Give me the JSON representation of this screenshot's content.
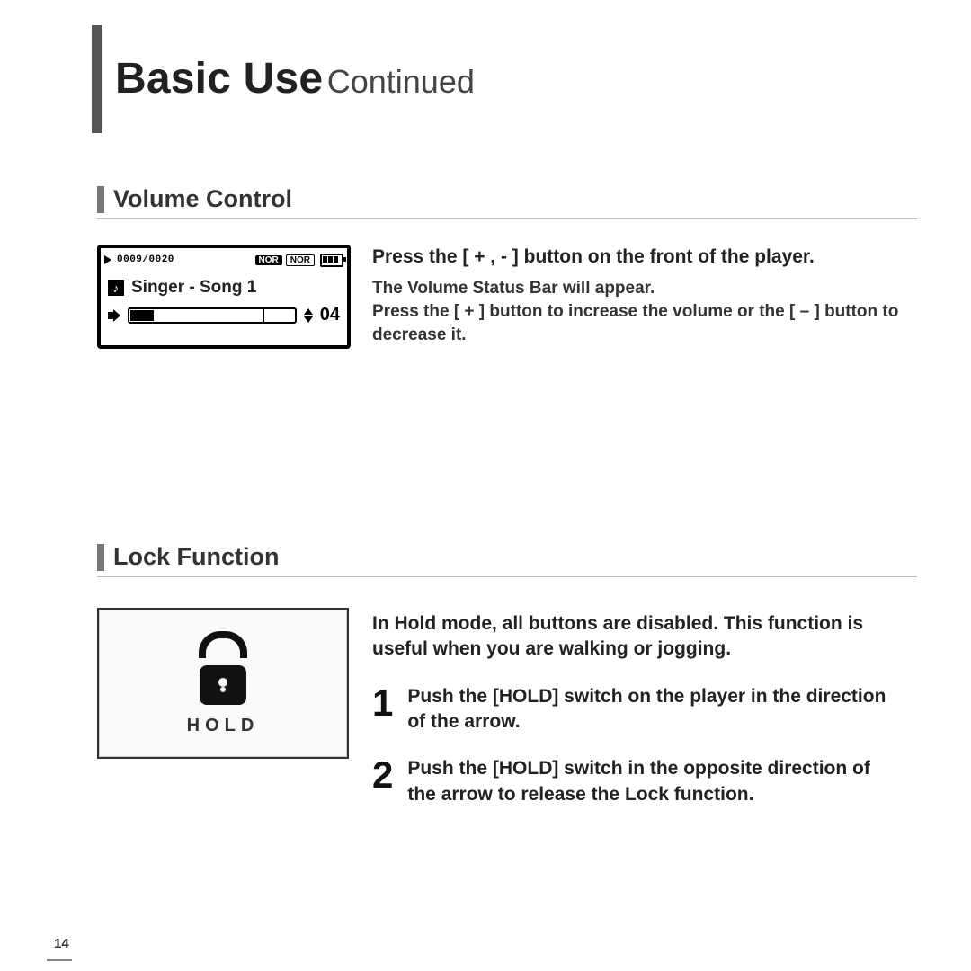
{
  "title": {
    "main": "Basic Use",
    "cont": "Continued"
  },
  "sections": {
    "volume": {
      "label": "Volume Control",
      "lead": "Press the [ + , - ] button on the front of the player.",
      "body1": "The Volume Status Bar will appear.",
      "body2": "Press the [ + ] button to increase the volume or the [ – ] button to decrease it.",
      "lcd": {
        "counter": "0009/0020",
        "badge1": "NOR",
        "badge2": "NOR",
        "song": "Singer - Song 1",
        "volume_value": "04"
      }
    },
    "lock": {
      "label": "Lock Function",
      "lead": "In Hold mode, all buttons are disabled. This function is useful when you are walking or jogging.",
      "hold_label": "HOLD",
      "steps": [
        {
          "n": "1",
          "t": "Push the [HOLD] switch on the player in the direction of the arrow."
        },
        {
          "n": "2",
          "t": "Push the [HOLD] switch in the opposite direction of the arrow to release the Lock function."
        }
      ]
    }
  },
  "page_number": "14"
}
